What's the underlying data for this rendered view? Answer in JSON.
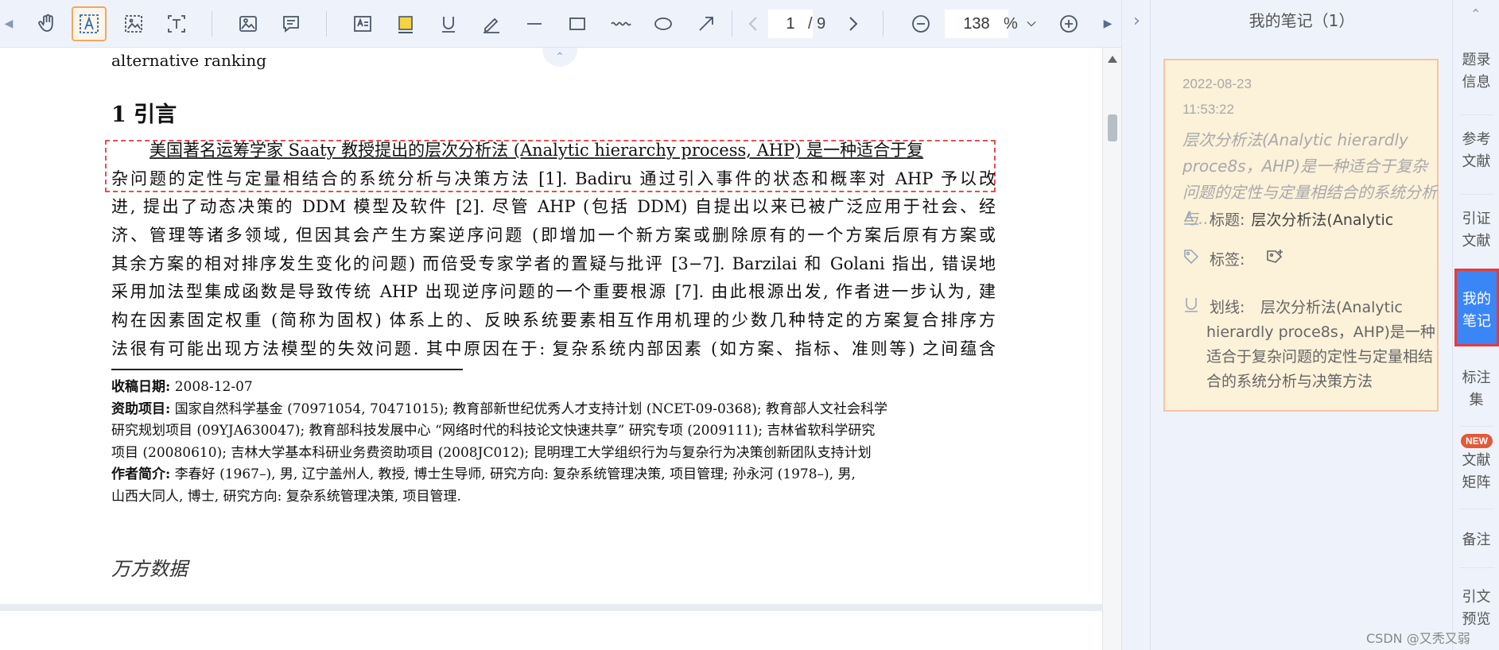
{
  "toolbar": {
    "page_current": "1",
    "page_total": "/ 9",
    "zoom_value": "138",
    "zoom_unit": "%"
  },
  "document": {
    "top_line": "alternative ranking",
    "heading": "1  引言",
    "paragraph_lines": [
      "美国著名运筹学家 Saaty 教授提出的层次分析法 (Analytic hierarchy process, AHP) 是一种适合于复",
      "杂问题的定性与定量相结合的系统分析与决策方法 [1]. Badiru 通过引入事件的状态和概率对 AHP 予以改",
      "进, 提出了动态决策的 DDM 模型及软件 [2]. 尽管 AHP (包括 DDM) 自提出以来已被广泛应用于社会、经",
      "济、管理等诸多领域, 但因其会产生方案逆序问题 (即增加一个新方案或删除原有的一个方案后原有方案或",
      "其余方案的相对排序发生变化的问题) 而倍受专家学者的置疑与批评 [3−7]. Barzilai 和 Golani 指出, 错误地",
      "采用加法型集成函数是导致传统 AHP 出现逆序问题的一个重要根源 [7]. 由此根源出发, 作者进一步认为, 建",
      "构在因素固定权重 (简称为固权) 体系上的、反映系统要素相互作用机理的少数几种特定的方案复合排序方",
      "法很有可能出现方法模型的失效问题. 其中原因在于: 复杂系统内部因素 (如方案、指标、准则等) 之间蕴含"
    ],
    "footnote": {
      "received_label": "收稿日期:",
      "received_value": "2008-12-07",
      "fund_label": "资助项目:",
      "fund_lines": [
        "国家自然科学基金 (70971054, 70471015); 教育部新世纪优秀人才支持计划 (NCET-09-0368); 教育部人文社会科学",
        "研究规划项目 (09YJA630047); 教育部科技发展中心 “网络时代的科技论文快速共享” 研究专项 (2009111); 吉林省软科学研究",
        "项目 (20080610); 吉林大学基本科研业务费资助项目 (2008JC012); 昆明理工大学组织行为与复杂行为决策创新团队支持计划"
      ],
      "author_label": "作者简介:",
      "author_lines": [
        "李春好 (1967–), 男, 辽宁盖州人, 教授, 博士生导师, 研究方向: 复杂系统管理决策, 项目管理; 孙永河 (1978–), 男,",
        "山西大同人, 博士, 研究方向: 复杂系统管理决策, 项目管理."
      ]
    },
    "watermark": "万方数据"
  },
  "notes": {
    "title": "我的笔记（1）",
    "card": {
      "date": "2022-08-23",
      "time": "11:53:22",
      "quote": "层次分析法(Analytic hierardly proce8s，AHP)是一种适合于复杂问题的定性与定量相结合的系统分析与...",
      "title_label": "标题:",
      "title_value": "层次分析法(Analytic",
      "tag_label": "标签:",
      "underline_label": "划线:",
      "underline_text": "层次分析法(Analytic hierardly proce8s，AHP)是一种适合于复杂问题的定性与定量相结合的系统分析与决策方法"
    }
  },
  "tabs": {
    "items": [
      {
        "line1": "题录",
        "line2": "信息"
      },
      {
        "line1": "参考",
        "line2": "文献"
      },
      {
        "line1": "引证",
        "line2": "文献"
      },
      {
        "line1": "我的",
        "line2": "笔记"
      },
      {
        "line1": "标注",
        "line2": "集"
      },
      {
        "line1": "文献",
        "line2": "矩阵"
      },
      {
        "line1": "备注",
        "line2": ""
      },
      {
        "line1": "引文",
        "line2": "预览"
      }
    ],
    "new_badge": "NEW"
  },
  "credit": "CSDN @又秃又弱",
  "colors": {
    "toolbar_bg": "#eef3fb",
    "active_tab": "#3b86f7",
    "active_tab_border": "#e53b3b",
    "note_card_bg": "#fcf1d9",
    "highlight_box": "#e05050",
    "highlight_tool": "#f5d442"
  }
}
